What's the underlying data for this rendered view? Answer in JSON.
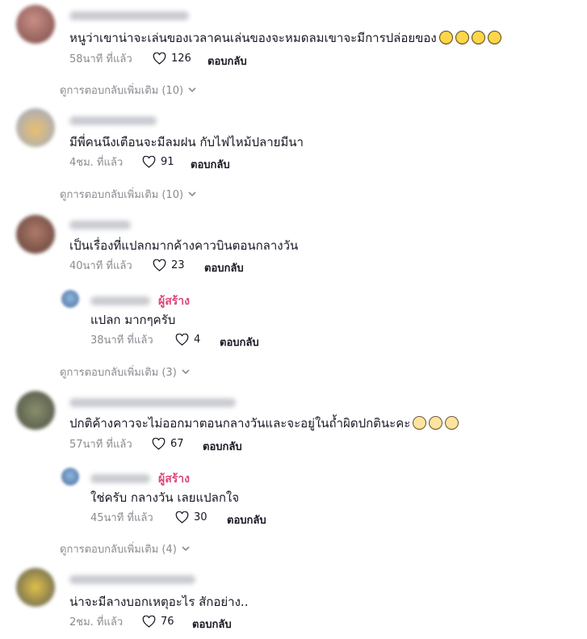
{
  "comments": [
    {
      "text": "หนูว่าเขาน่าจะเล่นของเวลาคนเล่นของจะหมดลมเขาจะมีการปล่อยของ",
      "emoji": "grinning-sweat",
      "emoji_count": 4,
      "time": "58นาที ที่แล้ว",
      "likes": "126",
      "reply": "ตอบกลับ",
      "more": "ดูการตอบกลับเพิ่มเติม (10)"
    },
    {
      "text": "มีพี่คนนึงเตือนจะมีลมฝน กับไฟไหม้ปลายมีนา",
      "time": "4ชม. ที่แล้ว",
      "likes": "91",
      "reply": "ตอบกลับ",
      "more": "ดูการตอบกลับเพิ่มเติม (10)"
    },
    {
      "text": "เป็นเรื่องที่แปลกมากค้างคาวบินตอนกลางวัน",
      "time": "40นาที ที่แล้ว",
      "likes": "23",
      "reply": "ตอบกลับ",
      "creator_reply": {
        "badge": "ผู้สร้าง",
        "text": "แปลก มากๆครับ",
        "time": "38นาที ที่แล้ว",
        "likes": "4",
        "reply": "ตอบกลับ"
      },
      "more": "ดูการตอบกลับเพิ่มเติม (3)"
    },
    {
      "text": "ปกติค้างคาวจะไม่ออกมาตอนกลางวันและจะอยู่ในถ้ำผิดปกตินะคะ",
      "emoji": "flushed-face",
      "emoji_count": 3,
      "time": "57นาที ที่แล้ว",
      "likes": "67",
      "reply": "ตอบกลับ",
      "creator_reply": {
        "badge": "ผู้สร้าง",
        "text": "ใช่ครับ กลางวัน เลยแปลกใจ",
        "time": "45นาที ที่แล้ว",
        "likes": "30",
        "reply": "ตอบกลับ"
      },
      "more": "ดูการตอบกลับเพิ่มเติม (4)"
    },
    {
      "text": "น่าจะมีลางบอกเหตุอะไร สักอย่าง..",
      "time": "2ชม. ที่แล้ว",
      "likes": "76",
      "reply": "ตอบกลับ"
    }
  ],
  "icons": {
    "like": "heart-icon",
    "expand": "chevron-down-icon"
  }
}
